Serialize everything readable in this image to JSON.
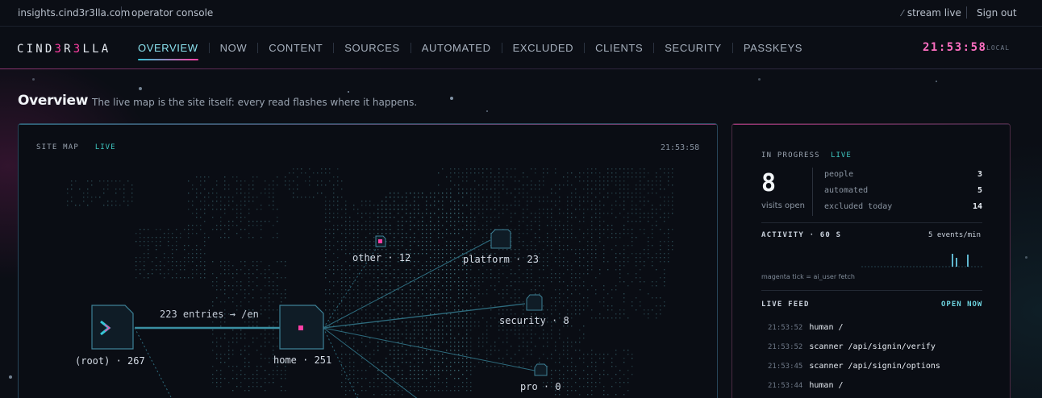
{
  "topbar": {
    "host": "insights.cind3r3lla.com",
    "console_label": "operator console",
    "stream_label": "stream live",
    "signout_label": "Sign out"
  },
  "brand": {
    "parts": [
      "CIND",
      "3",
      "R",
      "3",
      "LLA"
    ]
  },
  "nav": {
    "items": [
      {
        "label": "OVERVIEW",
        "active": true
      },
      {
        "label": "NOW"
      },
      {
        "label": "CONTENT"
      },
      {
        "label": "SOURCES"
      },
      {
        "label": "AUTOMATED"
      },
      {
        "label": "EXCLUDED"
      },
      {
        "label": "CLIENTS"
      },
      {
        "label": "SECURITY"
      },
      {
        "label": "PASSKEYS"
      }
    ],
    "clock": "21:53:58",
    "clock_label": "LOCAL"
  },
  "page": {
    "title": "Overview",
    "subtitle": "The live map is the site itself: every read flashes where it happens."
  },
  "sitemap": {
    "label": "SITE MAP",
    "live": "LIVE",
    "time": "21:53:58",
    "edge_label": "223 entries → /en",
    "nodes": {
      "root": "(root) · 267",
      "home": "home · 251",
      "other": "other · 12",
      "platform": "platform · 23",
      "security": "security · 8",
      "pro": "pro · 0"
    }
  },
  "progress": {
    "label": "IN PROGRESS",
    "live": "LIVE",
    "count": "8",
    "count_label": "visits open",
    "stats": [
      {
        "label": "people",
        "value": "3"
      },
      {
        "label": "automated",
        "value": "5"
      },
      {
        "label": "excluded today",
        "value": "14"
      }
    ],
    "activity_label": "ACTIVITY · 60 S",
    "activity_rate": "5 events/min",
    "activity_note": "magenta tick = ai_user fetch",
    "feed_label": "LIVE FEED",
    "feed_open": "OPEN NOW",
    "feed": [
      {
        "time": "21:53:52",
        "event": "human /"
      },
      {
        "time": "21:53:52",
        "event": "scanner /api/signin/verify"
      },
      {
        "time": "21:53:45",
        "event": "scanner /api/signin/options"
      },
      {
        "time": "21:53:44",
        "event": "human /"
      }
    ]
  },
  "colors": {
    "accent_cyan": "#36c6d6",
    "accent_magenta": "#ff3fa4",
    "background": "#0b0e15"
  }
}
